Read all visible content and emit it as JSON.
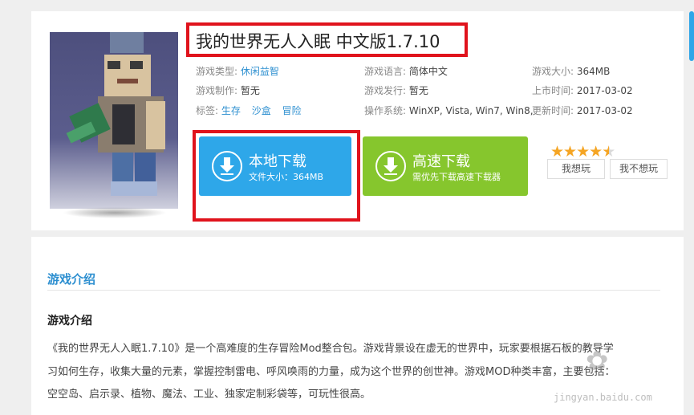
{
  "game": {
    "title": "我的世界无人入眠 中文版1.7.10"
  },
  "meta": {
    "type_label": "游戏类型:",
    "type_value": "休闲益智",
    "lang_label": "游戏语言:",
    "lang_value": "简体中文",
    "size_label": "游戏大小:",
    "size_value": "364MB",
    "dev_label": "游戏制作:",
    "dev_value": "暂无",
    "pub_label": "游戏发行:",
    "pub_value": "暂无",
    "release_label": "上市时间:",
    "release_value": "2017-03-02",
    "tags_label": "标签:",
    "tags": [
      "生存",
      "沙盒",
      "冒险"
    ],
    "os_label": "操作系统:",
    "os_value": "WinXP, Vista, Win7, Win8,",
    "update_label": "更新时间:",
    "update_value": "2017-03-02"
  },
  "download": {
    "local_label": "本地下载",
    "local_sub": "文件大小：364MB",
    "fast_label": "高速下载",
    "fast_sub": "需优先下载高速下载器"
  },
  "rating": {
    "stars": 4.5,
    "max": 5,
    "want_label": "我想玩",
    "not_want_label": "我不想玩"
  },
  "intro": {
    "heading": "游戏介绍",
    "subheading": "游戏介绍",
    "line1": "《我的世界无人入眠1.7.10》是一个高难度的生存冒险Mod整合包。游戏背景设在虚无的世界中，玩家要根据石板的教导学",
    "line2": "习如何生存，收集大量的元素，掌握控制雷电、呼风唤雨的力量，成为这个世界的创世神。游戏MOD种类丰富，主要包括：",
    "line3": "空空岛、启示录、植物、魔法、工业、独家定制彩袋等，可玩性很高。"
  },
  "watermark": {
    "text": "jingyan.baidu.com"
  },
  "colors": {
    "accent_blue": "#2ea7e9",
    "accent_green": "#86c62d",
    "highlight_red": "#e0131c",
    "link_blue": "#2d8fd0",
    "star_orange": "#f5a524"
  }
}
